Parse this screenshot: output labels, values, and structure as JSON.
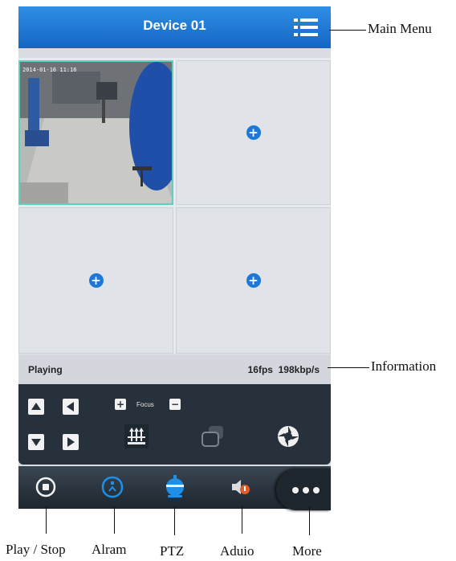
{
  "app": {
    "title": "Device 01"
  },
  "video": {
    "timestamp": "2014-01-16 11:16",
    "add_icon": "plus-circle-icon"
  },
  "status": {
    "state": "Playing",
    "stats": "16fps  198kbp/s"
  },
  "ptz": {
    "focus_label": "Focus",
    "plus": "+",
    "minus": "−"
  },
  "annotations": {
    "main_menu": "Main Menu",
    "information": "Information",
    "play_stop": "Play / Stop",
    "alarm": "Alram",
    "ptz": "PTZ",
    "audio": "Aduio",
    "more": "More"
  },
  "colors": {
    "title_bar": "#1a74d2",
    "accent": "#1d78d6",
    "alarm_icon": "#1d8fe8",
    "audio_icon": "#e25b2a",
    "control_panel": "#27313b"
  }
}
